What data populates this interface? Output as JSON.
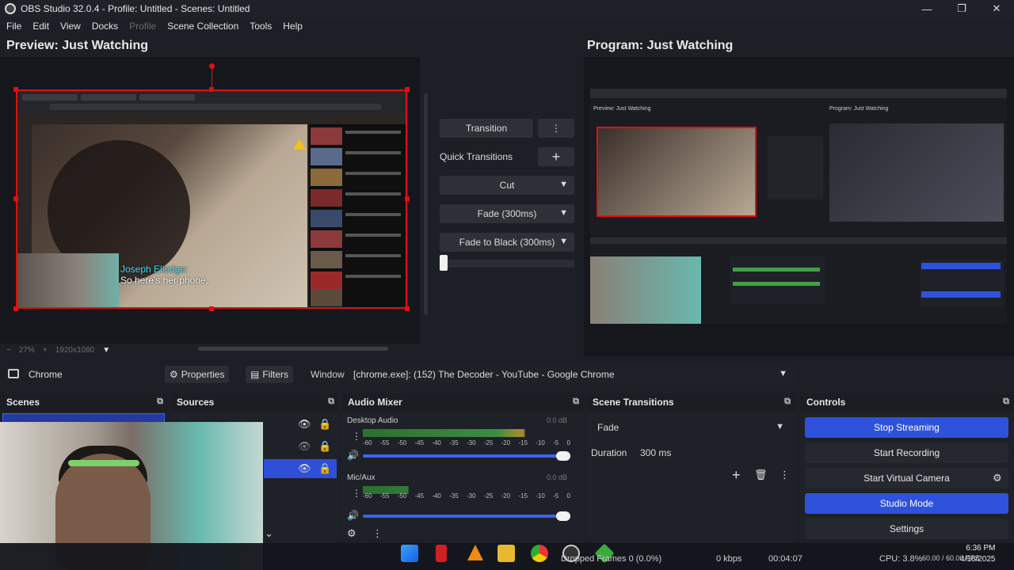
{
  "window": {
    "title": "OBS Studio 32.0.4 - Profile: Untitled - Scenes: Untitled",
    "minimize_glyph": "—",
    "maximize_glyph": "❐",
    "close_glyph": "✕"
  },
  "menu": [
    "File",
    "Edit",
    "View",
    "Docks",
    "Profile",
    "Scene Collection",
    "Tools",
    "Help"
  ],
  "preview": {
    "title": "Preview: Just Watching",
    "caption_speaker": "Joseph Elledge:",
    "caption_text": "So here's her phone.",
    "zoom": "27%",
    "status_extra": "1920x1080"
  },
  "program": {
    "title": "Program: Just Watching",
    "mini_preview_label": "Preview: Just Watching",
    "mini_program_label": "Program: Just Watching"
  },
  "transitions_panel": {
    "transition_label": "Transition",
    "quick_label": "Quick Transitions",
    "items": [
      "Cut",
      "Fade (300ms)",
      "Fade to Black (300ms)"
    ],
    "more_glyph": "⋮",
    "add_glyph": "+"
  },
  "source_toolbar": {
    "source_name": "Chrome",
    "properties_label": "Properties",
    "filters_label": "Filters",
    "window_label": "Window",
    "window_value": "[chrome.exe]: (152) The Decoder - YouTube - Google Chrome"
  },
  "docks": {
    "scenes_title": "Scenes",
    "sources_title": "Sources",
    "mixer_title": "Audio Mixer",
    "transitions_title": "Scene Transitions",
    "controls_title": "Controls",
    "undock_glyph": "⧉"
  },
  "mixer": {
    "tracks": [
      {
        "name": "Desktop Audio",
        "db": "0.0 dB",
        "level": 0.78
      },
      {
        "name": "Mic/Aux",
        "db": "0.0 dB",
        "level": 0.22
      }
    ],
    "scale": [
      "-60",
      "-55",
      "-50",
      "-45",
      "-40",
      "-35",
      "-30",
      "-25",
      "-20",
      "-15",
      "-10",
      "-5",
      "0"
    ]
  },
  "scene_transitions": {
    "selected": "Fade",
    "duration_label": "Duration",
    "duration_value": "300 ms"
  },
  "controls": {
    "buttons": [
      {
        "label": "Stop Streaming",
        "active": true
      },
      {
        "label": "Start Recording",
        "active": false
      },
      {
        "label": "Start Virtual Camera",
        "active": false
      },
      {
        "label": "Studio Mode",
        "active": true
      },
      {
        "label": "Settings",
        "active": false
      }
    ]
  },
  "statusbar": {
    "dropped": "Dropped Frames 0 (0.0%)",
    "kbps": "0 kbps",
    "live_time": "00:04:07",
    "cpu": "CPU: 3.8%",
    "fps": "60.00 / 60.00 FPS",
    "clock_time": "6:36 PM",
    "clock_date": "4/16/2025"
  },
  "colors": {
    "accent": "#2f52dc",
    "selection_red": "#e01010",
    "background": "#1d1f26"
  }
}
